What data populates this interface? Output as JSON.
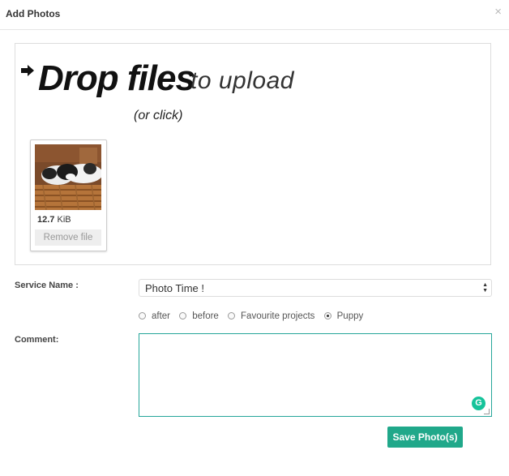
{
  "modal": {
    "title": "Add Photos",
    "close_glyph": "×"
  },
  "dropzone": {
    "main": "Drop files",
    "sub": "to upload",
    "click_hint": "(or click)",
    "file": {
      "size_value": "12.7",
      "size_unit": "KiB",
      "remove_label": "Remove file"
    }
  },
  "form": {
    "service_label": "Service Name :",
    "service_value": "Photo Time !",
    "radios": [
      {
        "label": "after",
        "checked": false
      },
      {
        "label": "before",
        "checked": false
      },
      {
        "label": "Favourite projects",
        "checked": false
      },
      {
        "label": "Puppy",
        "checked": true
      }
    ],
    "comment_label": "Comment:",
    "comment_value": ""
  },
  "save_label": "Save Photo(s)",
  "colors": {
    "accent": "#20a88a",
    "textarea_border": "#26a69a"
  }
}
